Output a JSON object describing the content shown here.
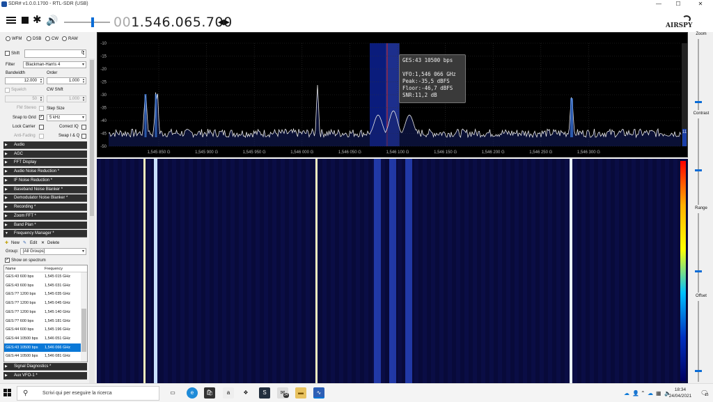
{
  "window": {
    "title": "SDR# v1.0.0.1700 - RTL-SDR (USB)",
    "minimize": "—",
    "maximize": "☐",
    "close": "✕"
  },
  "toolbar": {
    "freq_prefix": "00",
    "freq_main": "1.546.065.700",
    "freq_arrows": "◀▶",
    "volume": 0.62,
    "logo": "AIRSPY"
  },
  "source": {
    "modes": [
      "WFM",
      "DSB",
      "CW",
      "RAW"
    ],
    "shift_label": "Shift",
    "shift_value": "0",
    "filter_label": "Filter",
    "filter_value": "Blackman-Harris 4",
    "bandwidth_label": "Bandwidth",
    "bandwidth_value": "12.000",
    "order_label": "Order",
    "order_value": "1.000",
    "squelch_label": "Squelch",
    "squelch_value": "50",
    "cwshift_label": "CW Shift",
    "cwshift_value": "1.000",
    "fm_stereo_label": "FM Stereo",
    "step_size_label": "Step Size",
    "snap_label": "Snap to Grid",
    "snap_value": "5 kHz",
    "lock_carrier_label": "Lock Carrier",
    "correct_iq_label": "Correct IQ",
    "anti_fading_label": "Anti-Fading",
    "swap_iq_label": "Swap I & Q"
  },
  "sections_top": [
    "Audio",
    "AGC",
    "FFT Display",
    "Audio Noise Reduction *",
    "IF Noise Reduction *",
    "Baseband Noise Blanker *",
    "Demodulator Noise Blanker *",
    "Recording *",
    "Zoom FFT *",
    "Band Plan *",
    "Frequency Manager *"
  ],
  "freqman": {
    "new_label": "New",
    "edit_label": "Edit",
    "delete_label": "Delete",
    "group_label": "Group:",
    "group_value": "[All Groups]",
    "show_on_spectrum_label": "Show on spectrum",
    "col_name": "Name",
    "col_freq": "Frequency",
    "rows": [
      {
        "name": "GES:43  600 bps",
        "freq": "1,545 015 GHz"
      },
      {
        "name": "GES:43  600 bps",
        "freq": "1,545 031 GHz"
      },
      {
        "name": "GES:??  1200 bps",
        "freq": "1,545 035 GHz"
      },
      {
        "name": "GES:??  1200 bps",
        "freq": "1,545 045 GHz"
      },
      {
        "name": "GES:??  1200 bps",
        "freq": "1,545 140 GHz"
      },
      {
        "name": "GES:??  600 bps",
        "freq": "1,545 181 GHz"
      },
      {
        "name": "GES:44  600 bps",
        "freq": "1,545 196 GHz"
      },
      {
        "name": "GES:44  10500 bps",
        "freq": "1,546 051 GHz"
      },
      {
        "name": "GES:43  10500 bps",
        "freq": "1,546 066 GHz"
      },
      {
        "name": "GES:44  10500 bps",
        "freq": "1,546 081 GHz"
      }
    ],
    "selected_index": 8
  },
  "sections_bottom": [
    "Signal Diagnostics *",
    "Aux VFO-1 *"
  ],
  "spectrum": {
    "y_ticks": [
      "-10",
      "-15",
      "-20",
      "-25",
      "-30",
      "-35",
      "-40",
      "-45",
      "-50"
    ],
    "x_ticks": [
      "1,545 850 G",
      "1,545 900 G",
      "1,545 950 G",
      "1,546 000 G",
      "1,546 050 G",
      "1,546 100 G",
      "1,546 150 G",
      "1,546 200 G",
      "1,546 250 G",
      "1,546 300 G"
    ],
    "level_marker": "11",
    "tooltip_title": "GES:43 10500 bps",
    "tooltip_vfo": "VFO:1,546 066 GHz",
    "tooltip_peak": "Peak:-35,5 dBFS",
    "tooltip_floor": "Floor:-46,7 dBFS",
    "tooltip_snr": "SNR:11,2 dB"
  },
  "right_panel": {
    "zoom_label": "Zoom",
    "contrast_label": "Contrast",
    "range_label": "Range",
    "offset_label": "Offset"
  },
  "taskbar": {
    "search_placeholder": "Scrivi qui per eseguire la ricerca",
    "mail_badge": "34",
    "time": "18:34",
    "date": "24/04/2021",
    "notif_badge": "15"
  },
  "colors": {
    "spectrum_bg": "#000000",
    "waterfall_bg": "#080a3a",
    "vfo_band": "#0b1f8a",
    "selection_blue": "#0a78d7",
    "accent_blue": "#0a6cd6"
  }
}
